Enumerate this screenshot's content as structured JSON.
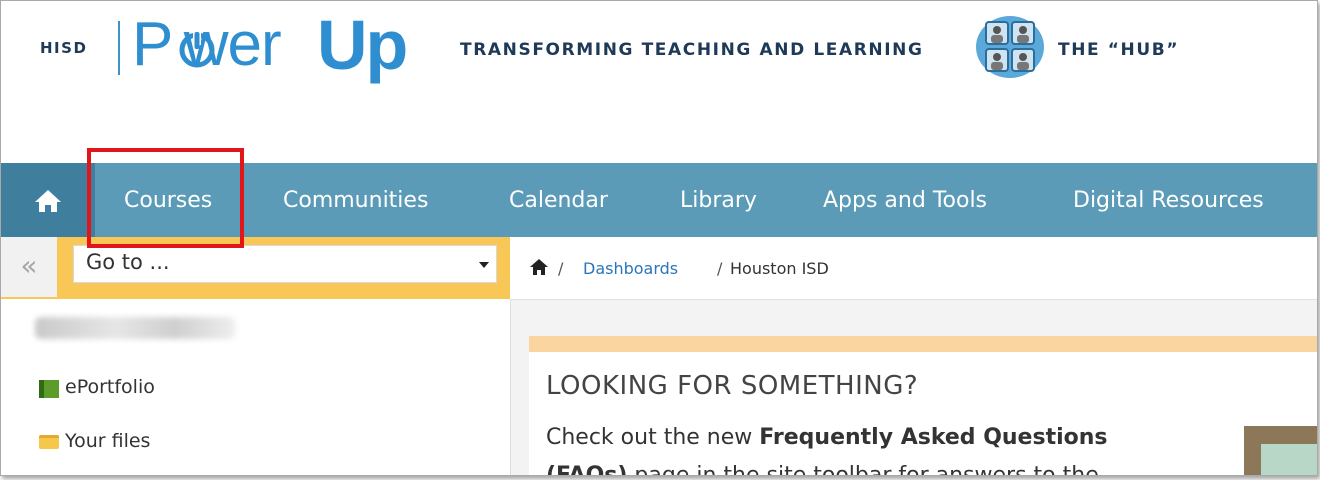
{
  "header": {
    "brand_left": "HISD",
    "brand_power": "P wer",
    "brand_up": "Up",
    "tagline": "TRANSFORMING TEACHING AND LEARNING",
    "hub": "THE “HUB”"
  },
  "nav": {
    "home_icon": "home-icon",
    "items": [
      "Courses",
      "Communities",
      "Calendar",
      "Library",
      "Apps and Tools",
      "Digital Resources"
    ]
  },
  "toolbar": {
    "collapse_label": "«",
    "goto_value": "Go to ..."
  },
  "breadcrumb": {
    "sep": "/",
    "dashboards": "Dashboards",
    "current": "Houston ISD"
  },
  "sidebar": {
    "items": [
      {
        "label": "ePortfolio",
        "icon": "book-icon"
      },
      {
        "label": "Your files",
        "icon": "folder-icon"
      }
    ]
  },
  "card": {
    "heading": "LOOKING FOR SOMETHING?",
    "line1_pre": "Check out the new ",
    "line1_bold": "Frequently Asked Questions",
    "line2_bold": "(FAQs)",
    "line2_post": " page in the site toolbar for answers to the"
  },
  "colors": {
    "nav_bg": "#5b9bb7",
    "nav_home_bg": "#3f7f9d",
    "brand_blue": "#2f8ed0",
    "highlight": "#e0161b",
    "accent_yellow": "#f8c755"
  }
}
